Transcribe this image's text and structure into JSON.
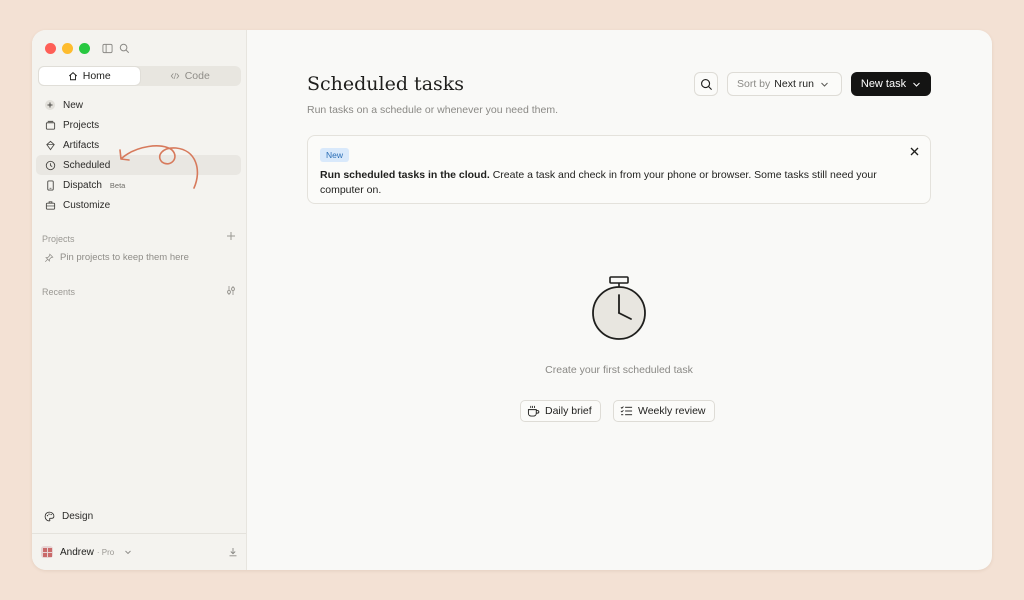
{
  "sidebar": {
    "segments": [
      {
        "label": "Home",
        "icon": "home-icon",
        "active": true
      },
      {
        "label": "Code",
        "icon": "code-icon",
        "active": false
      }
    ],
    "nav": [
      {
        "label": "New",
        "icon": "plus-circle-icon"
      },
      {
        "label": "Projects",
        "icon": "folder-icon"
      },
      {
        "label": "Artifacts",
        "icon": "artifact-icon"
      },
      {
        "label": "Scheduled",
        "icon": "clock-icon",
        "active": true
      },
      {
        "label": "Dispatch",
        "icon": "phone-icon",
        "badge": "Beta"
      },
      {
        "label": "Customize",
        "icon": "briefcase-icon"
      }
    ],
    "projects_label": "Projects",
    "projects_empty": "Pin projects to keep them here",
    "recents_label": "Recents",
    "design_label": "Design",
    "user": {
      "name": "Andrew",
      "plan": "· Pro"
    }
  },
  "main": {
    "title": "Scheduled tasks",
    "subtitle": "Run tasks on a schedule or whenever you need them.",
    "sort_prefix": "Sort by",
    "sort_value": "Next run",
    "new_task_label": "New task",
    "banner": {
      "badge": "New",
      "bold": "Run scheduled tasks in the cloud.",
      "text": " Create a task and check in from your phone or browser. Some tasks still need your computer on."
    },
    "empty_text": "Create your first scheduled task",
    "quick_actions": [
      {
        "label": "Daily brief",
        "icon": "coffee-icon"
      },
      {
        "label": "Weekly review",
        "icon": "checklist-icon"
      }
    ]
  },
  "colors": {
    "background": "#f3e1d4",
    "accent_dark": "#141413",
    "badge_blue": "#d9e9fb",
    "annotation_arrow": "#d77a5c"
  }
}
